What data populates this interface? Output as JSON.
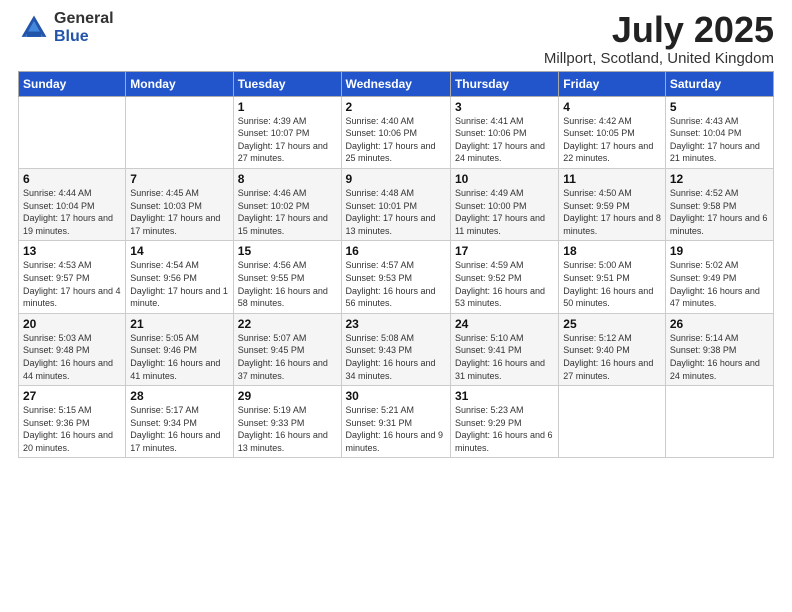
{
  "logo": {
    "general": "General",
    "blue": "Blue"
  },
  "header": {
    "title": "July 2025",
    "subtitle": "Millport, Scotland, United Kingdom"
  },
  "weekdays": [
    "Sunday",
    "Monday",
    "Tuesday",
    "Wednesday",
    "Thursday",
    "Friday",
    "Saturday"
  ],
  "weeks": [
    [
      {
        "day": "",
        "sunrise": "",
        "sunset": "",
        "daylight": "",
        "empty": true
      },
      {
        "day": "",
        "sunrise": "",
        "sunset": "",
        "daylight": "",
        "empty": true
      },
      {
        "day": "1",
        "sunrise": "Sunrise: 4:39 AM",
        "sunset": "Sunset: 10:07 PM",
        "daylight": "Daylight: 17 hours and 27 minutes."
      },
      {
        "day": "2",
        "sunrise": "Sunrise: 4:40 AM",
        "sunset": "Sunset: 10:06 PM",
        "daylight": "Daylight: 17 hours and 25 minutes."
      },
      {
        "day": "3",
        "sunrise": "Sunrise: 4:41 AM",
        "sunset": "Sunset: 10:06 PM",
        "daylight": "Daylight: 17 hours and 24 minutes."
      },
      {
        "day": "4",
        "sunrise": "Sunrise: 4:42 AM",
        "sunset": "Sunset: 10:05 PM",
        "daylight": "Daylight: 17 hours and 22 minutes."
      },
      {
        "day": "5",
        "sunrise": "Sunrise: 4:43 AM",
        "sunset": "Sunset: 10:04 PM",
        "daylight": "Daylight: 17 hours and 21 minutes."
      }
    ],
    [
      {
        "day": "6",
        "sunrise": "Sunrise: 4:44 AM",
        "sunset": "Sunset: 10:04 PM",
        "daylight": "Daylight: 17 hours and 19 minutes."
      },
      {
        "day": "7",
        "sunrise": "Sunrise: 4:45 AM",
        "sunset": "Sunset: 10:03 PM",
        "daylight": "Daylight: 17 hours and 17 minutes."
      },
      {
        "day": "8",
        "sunrise": "Sunrise: 4:46 AM",
        "sunset": "Sunset: 10:02 PM",
        "daylight": "Daylight: 17 hours and 15 minutes."
      },
      {
        "day": "9",
        "sunrise": "Sunrise: 4:48 AM",
        "sunset": "Sunset: 10:01 PM",
        "daylight": "Daylight: 17 hours and 13 minutes."
      },
      {
        "day": "10",
        "sunrise": "Sunrise: 4:49 AM",
        "sunset": "Sunset: 10:00 PM",
        "daylight": "Daylight: 17 hours and 11 minutes."
      },
      {
        "day": "11",
        "sunrise": "Sunrise: 4:50 AM",
        "sunset": "Sunset: 9:59 PM",
        "daylight": "Daylight: 17 hours and 8 minutes."
      },
      {
        "day": "12",
        "sunrise": "Sunrise: 4:52 AM",
        "sunset": "Sunset: 9:58 PM",
        "daylight": "Daylight: 17 hours and 6 minutes."
      }
    ],
    [
      {
        "day": "13",
        "sunrise": "Sunrise: 4:53 AM",
        "sunset": "Sunset: 9:57 PM",
        "daylight": "Daylight: 17 hours and 4 minutes."
      },
      {
        "day": "14",
        "sunrise": "Sunrise: 4:54 AM",
        "sunset": "Sunset: 9:56 PM",
        "daylight": "Daylight: 17 hours and 1 minute."
      },
      {
        "day": "15",
        "sunrise": "Sunrise: 4:56 AM",
        "sunset": "Sunset: 9:55 PM",
        "daylight": "Daylight: 16 hours and 58 minutes."
      },
      {
        "day": "16",
        "sunrise": "Sunrise: 4:57 AM",
        "sunset": "Sunset: 9:53 PM",
        "daylight": "Daylight: 16 hours and 56 minutes."
      },
      {
        "day": "17",
        "sunrise": "Sunrise: 4:59 AM",
        "sunset": "Sunset: 9:52 PM",
        "daylight": "Daylight: 16 hours and 53 minutes."
      },
      {
        "day": "18",
        "sunrise": "Sunrise: 5:00 AM",
        "sunset": "Sunset: 9:51 PM",
        "daylight": "Daylight: 16 hours and 50 minutes."
      },
      {
        "day": "19",
        "sunrise": "Sunrise: 5:02 AM",
        "sunset": "Sunset: 9:49 PM",
        "daylight": "Daylight: 16 hours and 47 minutes."
      }
    ],
    [
      {
        "day": "20",
        "sunrise": "Sunrise: 5:03 AM",
        "sunset": "Sunset: 9:48 PM",
        "daylight": "Daylight: 16 hours and 44 minutes."
      },
      {
        "day": "21",
        "sunrise": "Sunrise: 5:05 AM",
        "sunset": "Sunset: 9:46 PM",
        "daylight": "Daylight: 16 hours and 41 minutes."
      },
      {
        "day": "22",
        "sunrise": "Sunrise: 5:07 AM",
        "sunset": "Sunset: 9:45 PM",
        "daylight": "Daylight: 16 hours and 37 minutes."
      },
      {
        "day": "23",
        "sunrise": "Sunrise: 5:08 AM",
        "sunset": "Sunset: 9:43 PM",
        "daylight": "Daylight: 16 hours and 34 minutes."
      },
      {
        "day": "24",
        "sunrise": "Sunrise: 5:10 AM",
        "sunset": "Sunset: 9:41 PM",
        "daylight": "Daylight: 16 hours and 31 minutes."
      },
      {
        "day": "25",
        "sunrise": "Sunrise: 5:12 AM",
        "sunset": "Sunset: 9:40 PM",
        "daylight": "Daylight: 16 hours and 27 minutes."
      },
      {
        "day": "26",
        "sunrise": "Sunrise: 5:14 AM",
        "sunset": "Sunset: 9:38 PM",
        "daylight": "Daylight: 16 hours and 24 minutes."
      }
    ],
    [
      {
        "day": "27",
        "sunrise": "Sunrise: 5:15 AM",
        "sunset": "Sunset: 9:36 PM",
        "daylight": "Daylight: 16 hours and 20 minutes."
      },
      {
        "day": "28",
        "sunrise": "Sunrise: 5:17 AM",
        "sunset": "Sunset: 9:34 PM",
        "daylight": "Daylight: 16 hours and 17 minutes."
      },
      {
        "day": "29",
        "sunrise": "Sunrise: 5:19 AM",
        "sunset": "Sunset: 9:33 PM",
        "daylight": "Daylight: 16 hours and 13 minutes."
      },
      {
        "day": "30",
        "sunrise": "Sunrise: 5:21 AM",
        "sunset": "Sunset: 9:31 PM",
        "daylight": "Daylight: 16 hours and 9 minutes."
      },
      {
        "day": "31",
        "sunrise": "Sunrise: 5:23 AM",
        "sunset": "Sunset: 9:29 PM",
        "daylight": "Daylight: 16 hours and 6 minutes."
      },
      {
        "day": "",
        "sunrise": "",
        "sunset": "",
        "daylight": "",
        "empty": true
      },
      {
        "day": "",
        "sunrise": "",
        "sunset": "",
        "daylight": "",
        "empty": true
      }
    ]
  ]
}
